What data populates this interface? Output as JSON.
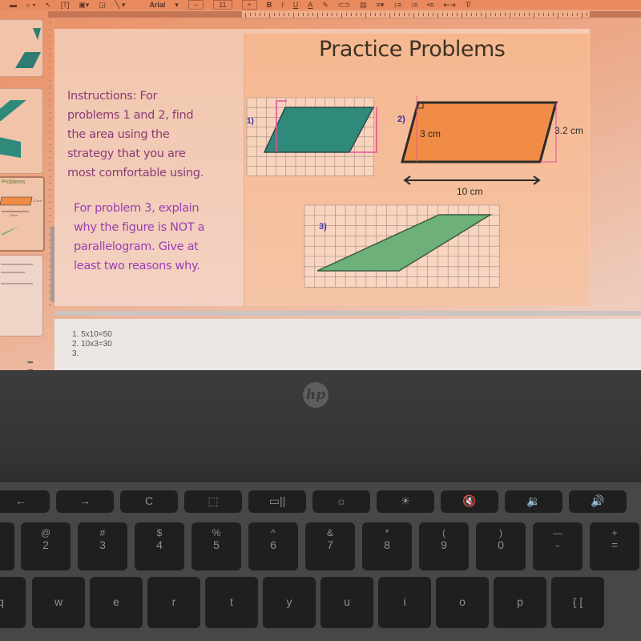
{
  "toolbar": {
    "items": [
      "paint-format",
      "zoom",
      "select",
      "text-box",
      "image",
      "shape",
      "line"
    ],
    "font_name": "Arial",
    "font_size_minus": "−",
    "font_size": "11",
    "font_size_plus": "+",
    "bold": "B",
    "italic": "I",
    "underline": "U",
    "text_color": "A"
  },
  "slide": {
    "title": "Practice Problems",
    "instructions_1": [
      "Instructions: For",
      "problems 1 and 2, find",
      "the area using the",
      "strategy that you are",
      "most comfortable using."
    ],
    "instructions_2": [
      "For problem 3, explain",
      "why the figure is NOT a",
      "parallelogram. Give at",
      "least two reasons why."
    ],
    "problem_1": {
      "label": "1)"
    },
    "problem_2": {
      "label": "2)",
      "height_label": "3 cm",
      "side_label": "3.2 cm",
      "base_label": "10 cm"
    },
    "problem_3": {
      "label": "3)"
    },
    "colors": {
      "teal": "#2f8a7c",
      "orange": "#f08c46",
      "green": "#6eb07a",
      "pink": "#e0529a",
      "label_blue": "#3a2fa8"
    }
  },
  "filmstrip": {
    "thumb_3_title": "Problems",
    "thumb_3_labels": [
      "3.2cm",
      "10cm"
    ]
  },
  "speaker_notes": {
    "lines": [
      "1. 5x10=50",
      "2. 10x3=30",
      "3."
    ]
  },
  "laptop": {
    "brand": "hp",
    "fn_row": [
      "←",
      "→",
      "C",
      "⬚",
      "▭||",
      "☼",
      "☀",
      "🔇",
      "🔉",
      "🔊"
    ],
    "num_row": [
      {
        "top": "@",
        "bot": "2"
      },
      {
        "top": "#",
        "bot": "3"
      },
      {
        "top": "$",
        "bot": "4"
      },
      {
        "top": "%",
        "bot": "5"
      },
      {
        "top": "^",
        "bot": "6"
      },
      {
        "top": "&",
        "bot": "7"
      },
      {
        "top": "*",
        "bot": "8"
      },
      {
        "top": "(",
        "bot": "9"
      },
      {
        "top": ")",
        "bot": "0"
      },
      {
        "top": "—",
        "bot": "-"
      },
      {
        "top": "+",
        "bot": "="
      }
    ],
    "letter_row": [
      "w",
      "e",
      "r",
      "t",
      "y",
      "u",
      "i",
      "o",
      "p",
      "{ ["
    ]
  }
}
